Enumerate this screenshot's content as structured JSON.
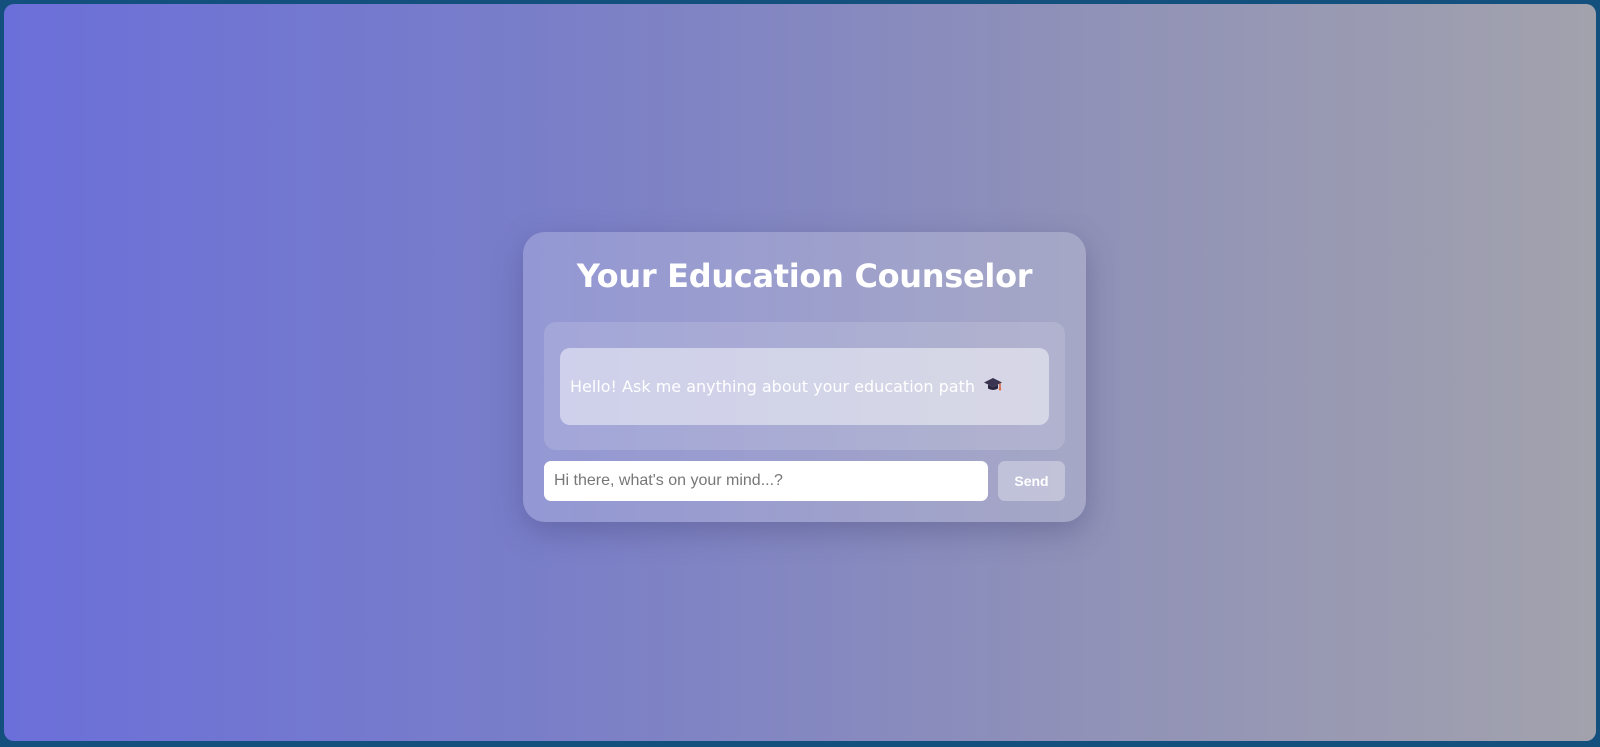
{
  "header": {
    "title": "Your Education Counselor"
  },
  "chat": {
    "messages": [
      {
        "text": "Hello! Ask me anything about your education path",
        "icon": "graduation-cap-icon"
      }
    ]
  },
  "composer": {
    "placeholder": "Hi there, what's on your mind...?",
    "value": "",
    "send_label": "Send"
  },
  "colors": {
    "gradient_start": "#6b6fd9",
    "gradient_end": "#a2a2ad",
    "frame": "#14507e"
  }
}
